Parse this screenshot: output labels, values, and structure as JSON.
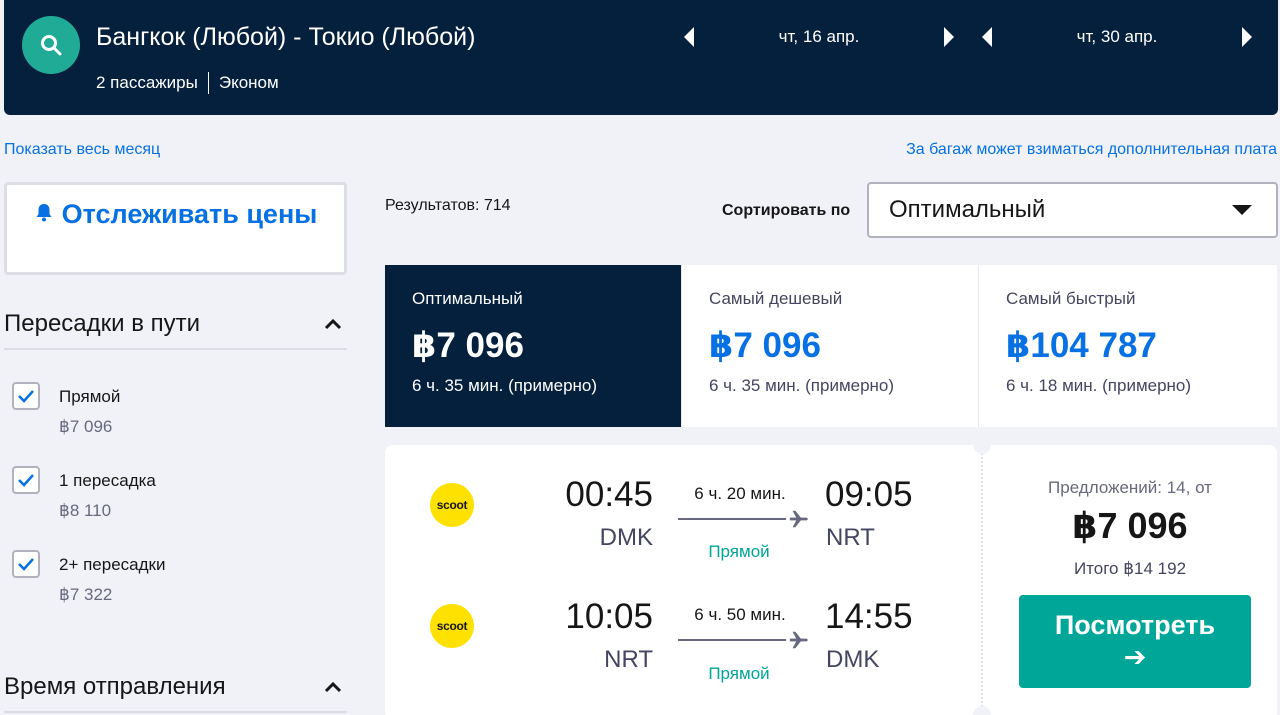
{
  "header": {
    "route": "Бангкок (Любой) - Токио (Любой)",
    "passengers": "2 пассажиры",
    "cabin": "Эконом",
    "outbound_date": "чт, 16 апр.",
    "return_date": "чт, 30 апр."
  },
  "links": {
    "show_month": "Показать весь месяц",
    "baggage_fee": "За багаж может взиматься дополнительная плата"
  },
  "sidebar": {
    "track_prices": "Отслеживать цены",
    "stops_filter": {
      "title": "Пересадки в пути",
      "options": [
        {
          "label": "Прямой",
          "price": "฿7 096",
          "checked": true
        },
        {
          "label": "1 пересадка",
          "price": "฿8 110",
          "checked": true
        },
        {
          "label": "2+ пересадки",
          "price": "฿7 322",
          "checked": true
        }
      ]
    },
    "departure_filter": {
      "title": "Время отправления"
    }
  },
  "results": {
    "count": "Результатов: 714",
    "sort_label": "Сортировать по",
    "sort_value": "Оптимальный"
  },
  "tabs": [
    {
      "label": "Оптимальный",
      "price": "฿7 096",
      "duration": "6 ч. 35 мин. (примерно)",
      "active": true
    },
    {
      "label": "Самый дешевый",
      "price": "฿7 096",
      "duration": "6 ч. 35 мин. (примерно)",
      "active": false
    },
    {
      "label": "Самый быстрый",
      "price": "฿104 787",
      "duration": "6 ч. 18 мин. (примерно)",
      "active": false
    }
  ],
  "ticket": {
    "legs": [
      {
        "airline_logo": "scoot",
        "dep_time": "00:45",
        "dep_code": "DMK",
        "duration": "6 ч. 20 мин.",
        "stops": "Прямой",
        "arr_time": "09:05",
        "arr_code": "NRT"
      },
      {
        "airline_logo": "scoot",
        "dep_time": "10:05",
        "dep_code": "NRT",
        "duration": "6 ч. 50 мин.",
        "stops": "Прямой",
        "arr_time": "14:55",
        "arr_code": "DMK"
      }
    ],
    "offers": "Предложений: 14, от",
    "price": "฿7 096",
    "total": "Итого ฿14 192",
    "view_button": "Посмотреть",
    "view_arrow": "➔"
  },
  "colors": {
    "header_bg": "#05203c",
    "accent_teal": "#00a698",
    "link_blue": "#0770e3",
    "airline_yellow": "#ffe100"
  }
}
